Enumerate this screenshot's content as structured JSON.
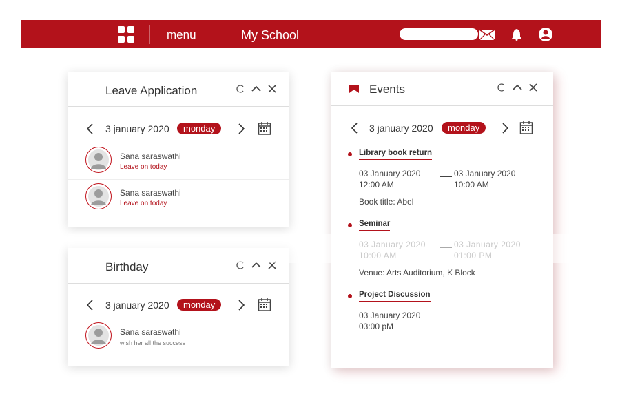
{
  "topbar": {
    "menu_label": "menu",
    "app_title": "My School",
    "search_value": "",
    "icons": [
      "grid-icon",
      "mail-icon",
      "bell-icon",
      "user-icon"
    ],
    "background": "#b3121b"
  },
  "leave": {
    "title": "Leave Application",
    "date": "3 january 2020",
    "day": "monday",
    "people": [
      {
        "name": "Sana saraswathi",
        "status": "Leave on today"
      },
      {
        "name": "Sana saraswathi",
        "status": "Leave on today"
      }
    ]
  },
  "birthday": {
    "title": "Birthday",
    "date": "3 january 2020",
    "day": "monday",
    "people": [
      {
        "name": "Sana saraswathi",
        "note": "wish her all the success"
      }
    ]
  },
  "events": {
    "title": "Events",
    "date": "3 january 2020",
    "day": "monday",
    "items": [
      {
        "title": "Library book return",
        "start_date": "03 January 2020",
        "start_time": "12:00 AM",
        "end_date": "03 January 2020",
        "end_time": "10:00 AM",
        "detail": "Book title: Abel"
      },
      {
        "title": "Seminar",
        "start_date": "03 January 2020",
        "start_time": "10:00 AM",
        "end_date": "03 January 2020",
        "end_time": "01:00 PM",
        "detail": "Venue: Arts Auditorium, K Block"
      },
      {
        "title": "Project Discussion",
        "start_date": "03 January 2020",
        "start_time": "03:00 pM"
      }
    ]
  },
  "colors": {
    "accent": "#b3121b",
    "divider": "#dddddd"
  }
}
